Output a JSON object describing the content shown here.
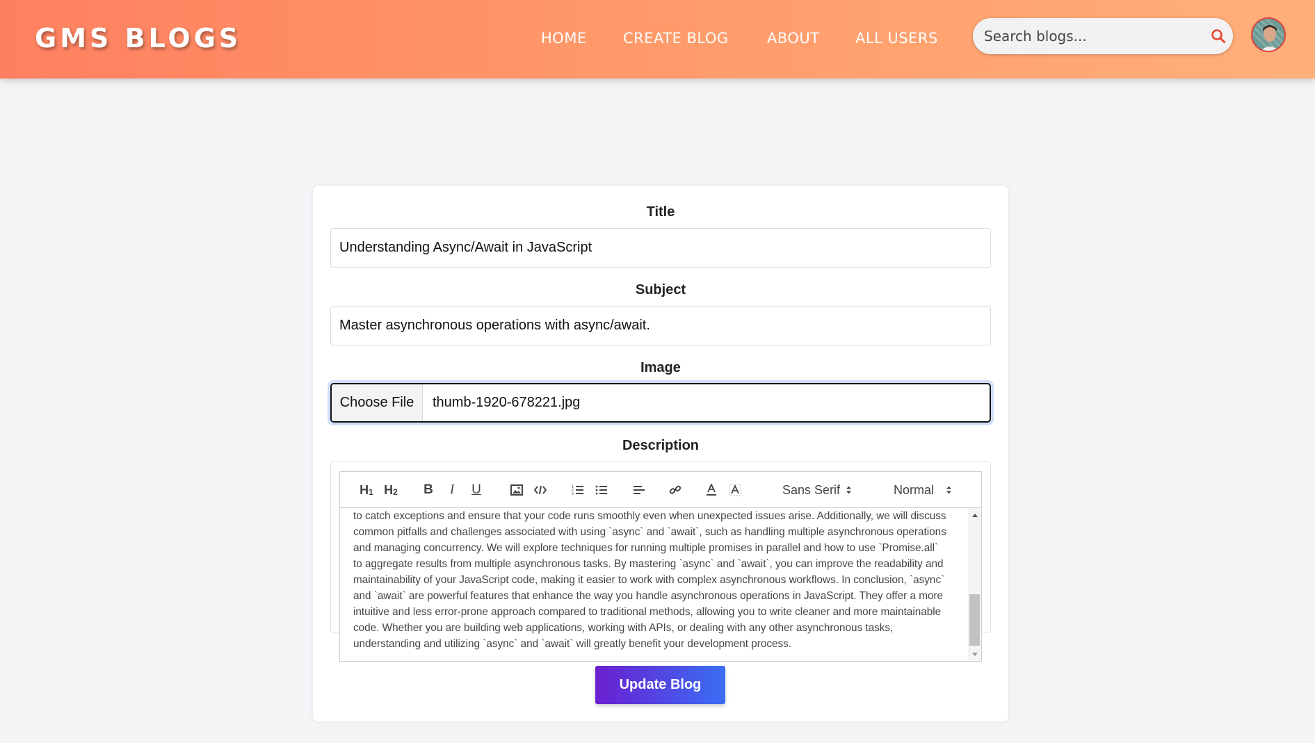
{
  "header": {
    "brand": "GMS BLOGS",
    "nav": [
      "HOME",
      "CREATE BLOG",
      "ABOUT",
      "ALL USERS"
    ],
    "search_placeholder": "Search blogs...",
    "search_icon": "search-icon",
    "accent_color": "#ff8060"
  },
  "form": {
    "title_label": "Title",
    "title_value": "Understanding Async/Await in JavaScript",
    "subject_label": "Subject",
    "subject_value": "Master asynchronous operations with async/await.",
    "image_label": "Image",
    "choose_file_label": "Choose File",
    "file_name": "thumb-1920-678221.jpg",
    "description_label": "Description",
    "toolbar": {
      "h1": "H1",
      "h2": "H2",
      "bold": "B",
      "italic": "I",
      "underline": "U",
      "font_picker": "Sans Serif",
      "size_picker": "Normal"
    },
    "description_lines": [
      "to catch exceptions and ensure that your code runs smoothly even when unexpected issues arise. Additionally, we will discuss",
      "common pitfalls and challenges associated with using `async` and `await`, such as handling multiple asynchronous operations",
      "and managing concurrency. We will explore techniques for running multiple promises in parallel and how to use `Promise.all`",
      "to aggregate results from multiple asynchronous tasks. By mastering `async` and `await`, you can improve the readability and",
      "maintainability of your JavaScript code, making it easier to work with complex asynchronous workflows. In conclusion, `async`",
      "and `await` are powerful features that enhance the way you handle asynchronous operations in JavaScript. They offer a more",
      "intuitive and less error-prone approach compared to traditional methods, allowing you to write cleaner and more maintainable",
      "code. Whether you are building web applications, working with APIs, or dealing with any other asynchronous tasks,",
      "understanding and utilizing `async` and `await` will greatly benefit your development process."
    ],
    "submit_label": "Update Blog",
    "submit_colors": [
      "#6a1fd0",
      "#3a6ef5"
    ]
  }
}
